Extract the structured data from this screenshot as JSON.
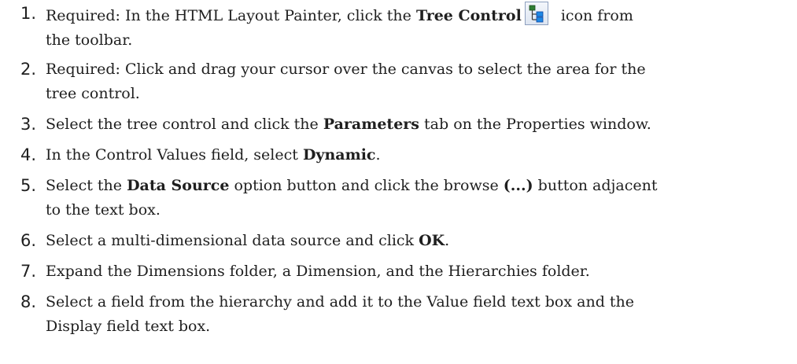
{
  "steps": [
    {
      "num": "1.",
      "text_a": "Required: In the HTML Layout Painter, click the ",
      "bold_a": "Tree Control",
      "text_b": " icon from",
      "text_c": "the toolbar.",
      "icon": "tree-control-icon"
    },
    {
      "num": "2.",
      "text_a": "Required: Click and drag your cursor over the canvas to select the area for the",
      "text_b": "tree control."
    },
    {
      "num": "3.",
      "text_a": "Select the tree control and click the ",
      "bold_a": "Parameters",
      "text_b": " tab on the Properties window."
    },
    {
      "num": "4.",
      "text_a": "In the Control Values field, select ",
      "bold_a": "Dynamic",
      "text_b": "."
    },
    {
      "num": "5.",
      "text_a": "Select the ",
      "bold_a": "Data Source",
      "text_b": " option button and click the browse ",
      "bold_b": "(...)",
      "text_c": " button adjacent",
      "text_d": "to the text box."
    },
    {
      "num": "6.",
      "text_a": "Select a multi-dimensional data source and click ",
      "bold_a": "OK",
      "text_b": "."
    },
    {
      "num": "7.",
      "text_a": "Expand the Dimensions folder, a Dimension, and the Hierarchies folder."
    },
    {
      "num": "8.",
      "text_a": "Select a field from the hierarchy and add it to the Value field text box and the",
      "text_b": "Display field text box."
    }
  ]
}
